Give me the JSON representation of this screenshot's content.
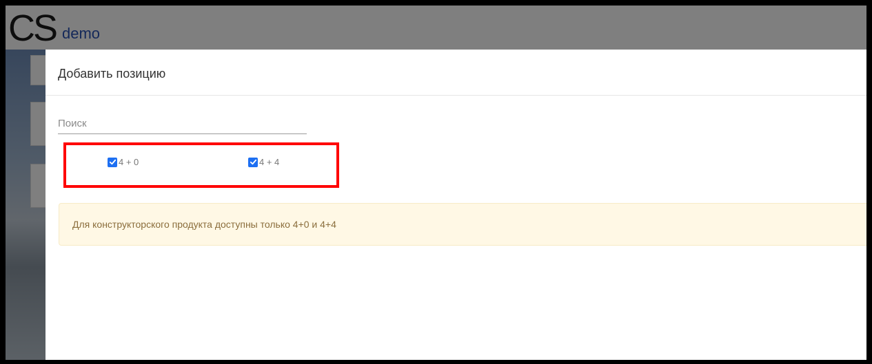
{
  "app": {
    "logo_text": "CS",
    "name": "demo"
  },
  "modal": {
    "title": "Добавить позицию",
    "search": {
      "placeholder": "Поиск",
      "value": ""
    },
    "options": [
      {
        "label": "4 + 0",
        "checked": true
      },
      {
        "label": "4 + 4",
        "checked": true
      }
    ],
    "alert_text": "Для конструкторского продукта доступны только 4+0 и 4+4"
  },
  "colors": {
    "checkbox_accent": "#1d6ff2",
    "highlight": "#ff0000",
    "alert_background": "#fff8e5",
    "app_name": "#2a53b4"
  }
}
